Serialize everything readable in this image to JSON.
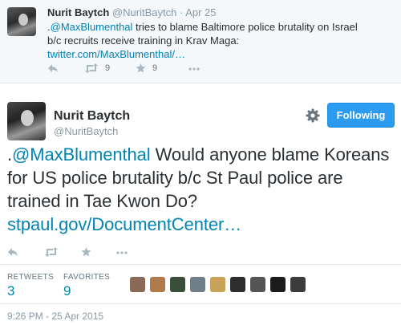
{
  "parent_tweet": {
    "name": "Nurit Baytch",
    "handle": "@NuritBaytch",
    "separator": "·",
    "date": "Apr 25",
    "text_prefix": ".",
    "mention": "@MaxBlumenthal",
    "text_body": " tries to blame Baltimore police brutality on Israel b/c recruits receive training in Krav Maga:",
    "link": "twitter.com/MaxBlumenthal/…",
    "retweet_count": "9",
    "favorite_count": "9"
  },
  "main_tweet": {
    "name": "Nurit Baytch",
    "handle": "@NuritBaytch",
    "follow_label": "Following",
    "text_prefix": ".",
    "mention": "@MaxBlumenthal",
    "text_body": " Would anyone blame Koreans for US police brutality b/c St Paul police are trained in Tae Kwon Do?",
    "link": "stpaul.gov/DocumentCenter…",
    "retweets_label": "RETWEETS",
    "retweets_count": "3",
    "favorites_label": "FAVORITES",
    "favorites_count": "9",
    "timestamp": "9:26 PM - 25 Apr 2015"
  },
  "favoriter_avatars": [
    {
      "name": "favoriter-1",
      "color": "#8a6a55"
    },
    {
      "name": "favoriter-2",
      "color": "#b07a4a"
    },
    {
      "name": "favoriter-3",
      "color": "#3a4f3a"
    },
    {
      "name": "favoriter-4",
      "color": "#6f7f8a"
    },
    {
      "name": "favoriter-5",
      "color": "#c9a25a"
    },
    {
      "name": "favoriter-6",
      "color": "#2d2d2d"
    },
    {
      "name": "favoriter-7",
      "color": "#555555"
    },
    {
      "name": "favoriter-8",
      "color": "#1c1c1c"
    },
    {
      "name": "favoriter-9",
      "color": "#3b3b3b"
    }
  ],
  "colors": {
    "link": "#0084b4",
    "button": "#2b9bf0",
    "muted": "#8899a6"
  }
}
